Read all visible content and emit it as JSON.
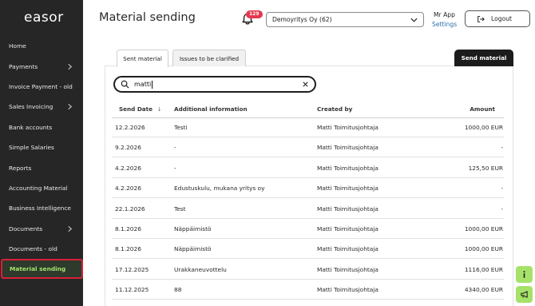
{
  "app": {
    "logo": "easor"
  },
  "sidebar": {
    "items": [
      {
        "label": "Home",
        "chevron": false,
        "active": false
      },
      {
        "label": "Payments",
        "chevron": true,
        "active": false
      },
      {
        "label": "Invoice Payment - old",
        "chevron": false,
        "active": false
      },
      {
        "label": "Sales Invoicing",
        "chevron": true,
        "active": false
      },
      {
        "label": "Bank accounts",
        "chevron": false,
        "active": false
      },
      {
        "label": "Simple Salaries",
        "chevron": false,
        "active": false
      },
      {
        "label": "Reports",
        "chevron": false,
        "active": false
      },
      {
        "label": "Accounting Material",
        "chevron": false,
        "active": false
      },
      {
        "label": "Business Intelligence",
        "chevron": false,
        "active": false
      },
      {
        "label": "Documents",
        "chevron": true,
        "active": false
      },
      {
        "label": "Documents - old",
        "chevron": false,
        "active": false
      },
      {
        "label": "Material sending",
        "chevron": false,
        "active": true
      }
    ]
  },
  "header": {
    "title": "Material sending",
    "notification_count": "129",
    "company": "Demoyritys Oy (62)",
    "user_name": "Mr App",
    "settings_label": "Settings",
    "logout_label": "Logout"
  },
  "tabs": [
    {
      "label": "Sent material",
      "active": true
    },
    {
      "label": "Issues to be clarified",
      "active": false
    }
  ],
  "send_button_label": "Send material",
  "search": {
    "value": "matti",
    "placeholder": ""
  },
  "table": {
    "headers": {
      "date": "Send Date",
      "info": "Additional information",
      "created_by": "Created by",
      "amount": "Amount"
    },
    "rows": [
      {
        "date": "12.2.2026",
        "info": "Testi",
        "created_by": "Matti Toimitusjohtaja",
        "amount": "1000,00 EUR"
      },
      {
        "date": "9.2.2026",
        "info": "-",
        "created_by": "Matti Toimitusjohtaja",
        "amount": "-"
      },
      {
        "date": "4.2.2026",
        "info": "-",
        "created_by": "Matti Toimitusjohtaja",
        "amount": "125,50 EUR"
      },
      {
        "date": "4.2.2026",
        "info": "Edustuskulu, mukana yritys oy",
        "created_by": "Matti Toimitusjohtaja",
        "amount": "-"
      },
      {
        "date": "22.1.2026",
        "info": "Test",
        "created_by": "Matti Toimitusjohtaja",
        "amount": "-"
      },
      {
        "date": "8.1.2026",
        "info": "Näppäimistö",
        "created_by": "Matti Toimitusjohtaja",
        "amount": "1000,00 EUR"
      },
      {
        "date": "8.1.2026",
        "info": "Näppäimistö",
        "created_by": "Matti Toimitusjohtaja",
        "amount": "1000,00 EUR"
      },
      {
        "date": "17.12.2025",
        "info": "Urakkaneuvottelu",
        "created_by": "Matti Toimitusjohtaja",
        "amount": "1116,00 EUR"
      },
      {
        "date": "11.12.2025",
        "info": "88",
        "created_by": "Matti Toimitusjohtaja",
        "amount": "4340,00 EUR"
      }
    ]
  },
  "colors": {
    "sidebar_bg": "#262626",
    "accent_green": "#a6e26a",
    "badge_red": "#e5374f",
    "active_outline": "#d8203a",
    "link_blue": "#2c6fb0"
  },
  "icons": {
    "bell": "bell-icon",
    "search": "search-icon",
    "clear": "close-icon",
    "logout": "logout-icon",
    "info": "info-icon",
    "feedback": "megaphone-icon"
  }
}
